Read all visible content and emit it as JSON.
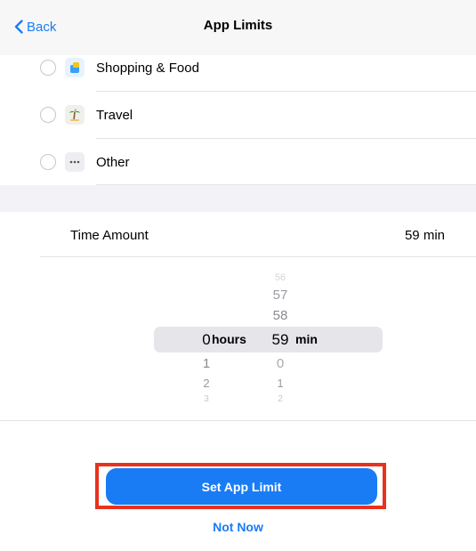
{
  "nav": {
    "back_label": "Back",
    "title": "App Limits"
  },
  "categories": [
    {
      "label": "Shopping & Food",
      "icon": "shopping-bag-icon",
      "color": "#3aa0f5"
    },
    {
      "label": "Travel",
      "icon": "palm-tree-icon",
      "color": "#f1efe9"
    },
    {
      "label": "Other",
      "icon": "ellipsis-icon",
      "color": "#eeeef2"
    }
  ],
  "time_amount": {
    "label": "Time Amount",
    "value": "59 min"
  },
  "picker": {
    "hours": {
      "selected": "0",
      "below": [
        "1",
        "2",
        "3"
      ],
      "unit": "hours"
    },
    "minutes": {
      "above": [
        "56",
        "57",
        "58"
      ],
      "selected": "59",
      "below": [
        "0",
        "1",
        "2"
      ],
      "unit": "min"
    }
  },
  "actions": {
    "primary_label": "Set App Limit",
    "secondary_label": "Not Now"
  },
  "colors": {
    "accent": "#1a7cf5",
    "highlight": "#e8321e"
  }
}
